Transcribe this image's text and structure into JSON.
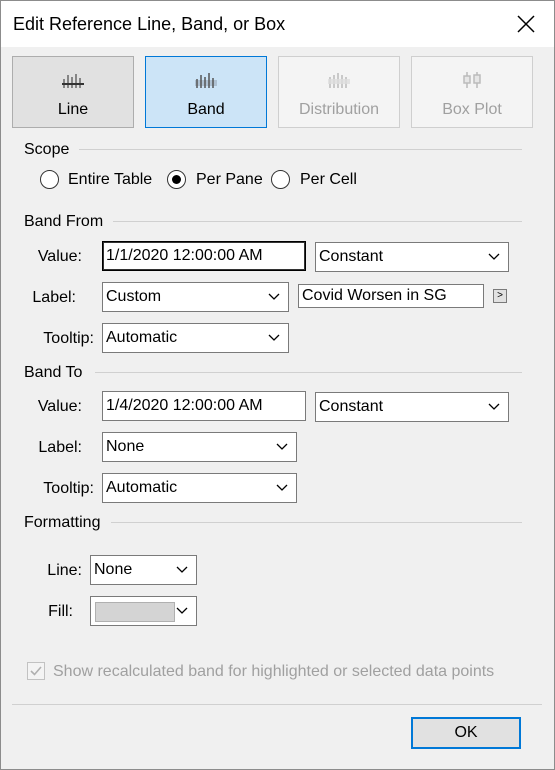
{
  "window": {
    "title": "Edit Reference Line, Band, or Box"
  },
  "types": [
    {
      "label": "Line",
      "icon": "line-chart-icon"
    },
    {
      "label": "Band",
      "icon": "band-chart-icon"
    },
    {
      "label": "Distribution",
      "icon": "distribution-chart-icon"
    },
    {
      "label": "Box Plot",
      "icon": "box-plot-icon"
    }
  ],
  "scope": {
    "title": "Scope",
    "options": [
      "Entire Table",
      "Per Pane",
      "Per Cell"
    ],
    "selected": "Per Pane"
  },
  "band_from": {
    "title": "Band From",
    "value_label": "Value:",
    "value": "1/1/2020 12:00:00 AM",
    "value_type": "Constant",
    "label_label": "Label:",
    "label_type": "Custom",
    "label_text": "Covid Worsen in SG",
    "expand_label": ">",
    "tooltip_label": "Tooltip:",
    "tooltip": "Automatic"
  },
  "band_to": {
    "title": "Band To",
    "value_label": "Value:",
    "value": "1/4/2020 12:00:00 AM",
    "value_type": "Constant",
    "label_label": "Label:",
    "label_type": "None",
    "tooltip_label": "Tooltip:",
    "tooltip": "Automatic"
  },
  "formatting": {
    "title": "Formatting",
    "line_label": "Line:",
    "line": "None",
    "fill_label": "Fill:",
    "fill_color": "#d4d4d4"
  },
  "recalc_label": "Show recalculated band for highlighted or selected data points",
  "ok_label": "OK"
}
